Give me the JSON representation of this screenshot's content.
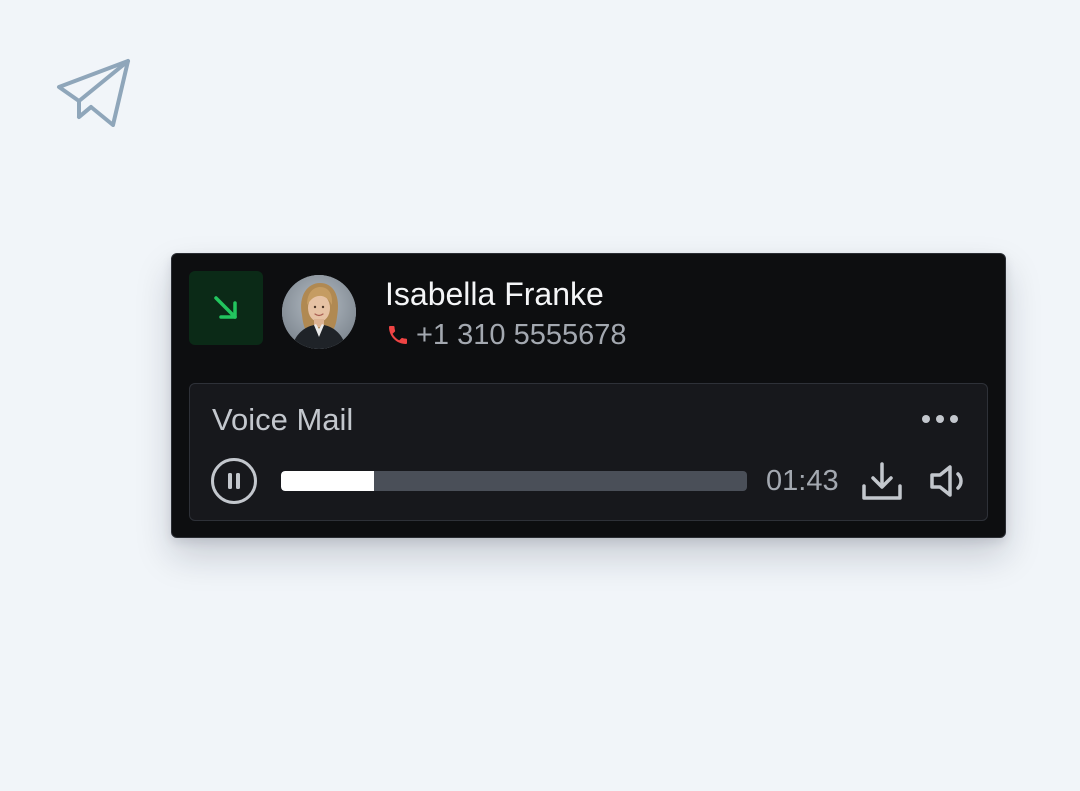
{
  "contact": {
    "name": "Isabella Franke",
    "phone": "+1 310 5555678",
    "call_direction_icon": "arrow-down-right-icon",
    "phone_icon": "phone-icon"
  },
  "voicemail": {
    "title": "Voice Mail",
    "time": "01:43",
    "progress": 0.2
  },
  "icons": {
    "decoration": "paper-plane-icon",
    "more": "more-dots-icon",
    "pause": "pause-icon",
    "download": "download-icon",
    "volume": "volume-icon"
  },
  "colors": {
    "background": "#f1f5f9",
    "card": "#0d0e10",
    "incoming_accent": "#22c55e",
    "incoming_badge": "#0b2a17",
    "phone_icon": "#ef4444",
    "progress_fill": "#ffffff",
    "progress_track": "#4a4f58"
  }
}
